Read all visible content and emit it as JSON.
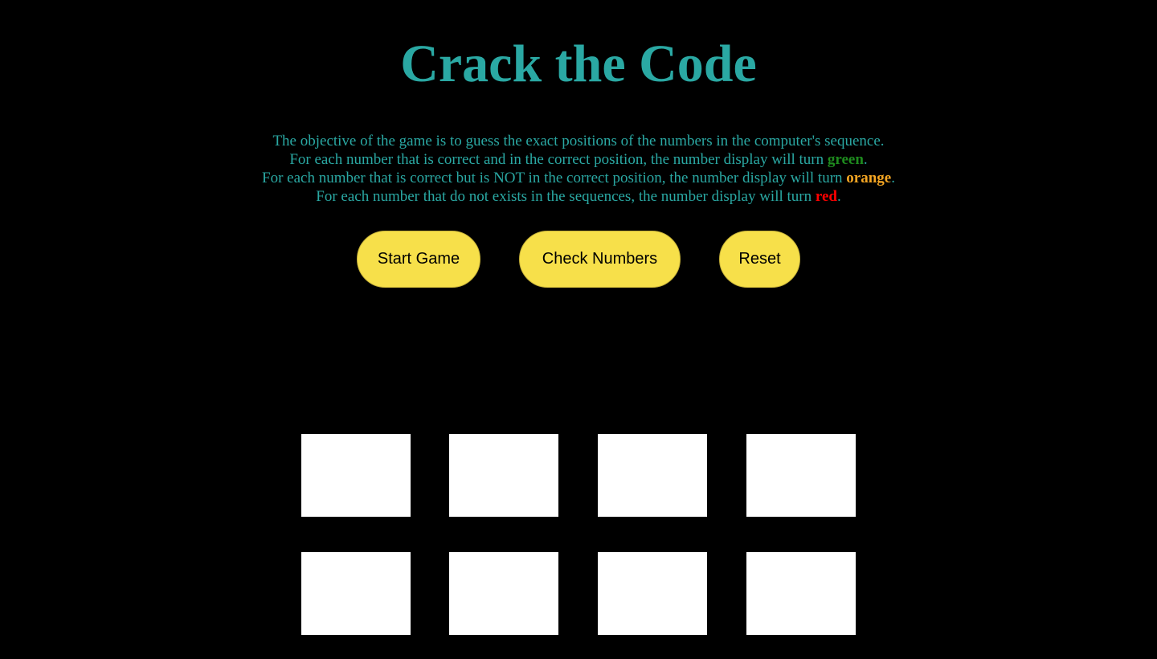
{
  "title": "Crack the Code",
  "colors": {
    "accent": "#2aa8a3",
    "button_bg": "#f7e04a",
    "green": "#1e8b1e",
    "orange": "#f5a623",
    "red": "#ff0000",
    "box": "#ffffff",
    "background": "#000000"
  },
  "instructions": {
    "line1": "The objective of the game is to guess the exact positions of the numbers in the computer's sequence.",
    "line2_pre": "For each number that is correct and in the correct position, the number display will turn ",
    "line2_word": "green",
    "line2_post": ".",
    "line3_pre": "For each number that is correct but is NOT in the correct position, the number display will turn ",
    "line3_word": "orange",
    "line3_post": ".",
    "line4_pre": "For each number that do not exists in the sequences, the number display will turn ",
    "line4_word": "red",
    "line4_post": "."
  },
  "buttons": {
    "start": "Start Game",
    "check": "Check Numbers",
    "reset": "Reset"
  },
  "computer_row": [
    "",
    "",
    "",
    ""
  ],
  "guess_row": [
    "",
    "",
    "",
    ""
  ]
}
